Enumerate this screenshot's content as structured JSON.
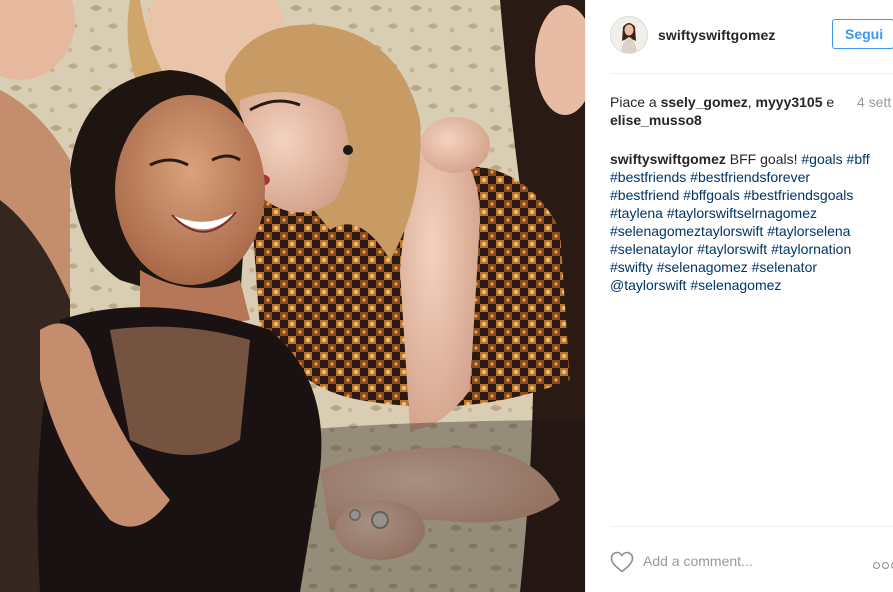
{
  "post": {
    "username": "swiftyswiftgomez",
    "follow_label": "Segui",
    "likes": {
      "prefix": "Piace a ",
      "user1": "ssely_gomez",
      "sep": ", ",
      "user2": "myyy3105",
      "conj": " e ",
      "user3": "elise_musso8"
    },
    "time_ago": "4 sett",
    "caption": {
      "author": "swiftyswiftgomez",
      "text": " BFF goals! ",
      "tags": [
        "#goals",
        "#bff",
        "#bestfriends",
        "#bestfriendsforever",
        "#bestfriend",
        "#bffgoals",
        "#bestfriendsgoals",
        "#taylena",
        "#taylorswiftselrnagomez",
        "#selenagomeztaylorswift",
        "#taylorselena",
        "#selenataylor",
        "#taylorswift",
        "#taylornation",
        "#swifty",
        "#selenagomez",
        "#selenator",
        "@taylorswift",
        "#selenagomez"
      ]
    },
    "comment_placeholder": "Add a comment..."
  },
  "colors": {
    "link_blue": "#3897f0",
    "hashtag": "#003569",
    "text": "#262626",
    "muted": "#999999"
  },
  "icons": {
    "like": "heart-icon",
    "options": "more-options-icon"
  }
}
